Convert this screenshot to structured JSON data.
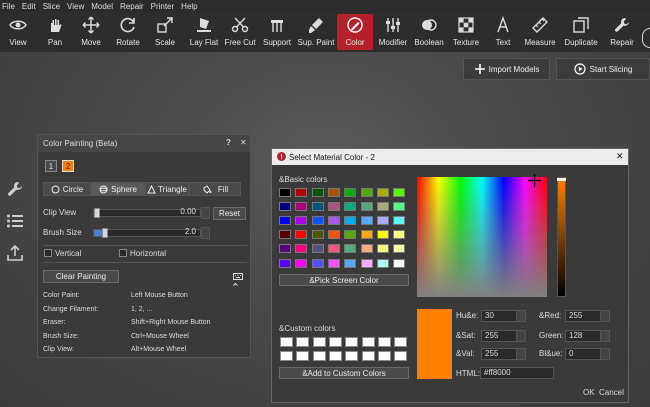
{
  "menu": [
    "File",
    "Edit",
    "Slice",
    "View",
    "Model",
    "Repair",
    "Printer",
    "Help"
  ],
  "toolbar": [
    {
      "label": "View",
      "icon": "eye-icon"
    },
    {
      "label": "Pan",
      "icon": "hand-icon"
    },
    {
      "label": "Move",
      "icon": "move-icon"
    },
    {
      "label": "Rotate",
      "icon": "rotate-icon"
    },
    {
      "label": "Scale",
      "icon": "scale-icon"
    },
    {
      "label": "Lay Flat",
      "icon": "lay-flat-icon"
    },
    {
      "label": "Free Cut",
      "icon": "cut-icon"
    },
    {
      "label": "Support",
      "icon": "support-icon"
    },
    {
      "label": "Sup. Paint",
      "icon": "support-paint-icon"
    },
    {
      "label": "Color",
      "icon": "color-icon"
    },
    {
      "label": "Modifier",
      "icon": "modifier-icon"
    },
    {
      "label": "Boolean",
      "icon": "boolean-icon"
    },
    {
      "label": "Texture",
      "icon": "texture-icon"
    },
    {
      "label": "Text",
      "icon": "text-icon"
    },
    {
      "label": "Measure",
      "icon": "ruler-icon"
    },
    {
      "label": "Duplicate",
      "icon": "duplicate-icon"
    },
    {
      "label": "Repair",
      "icon": "wrench-icon"
    }
  ],
  "top_actions": {
    "import": "Import Models",
    "slice": "Start Slicing"
  },
  "panel": {
    "title": "Color Painting (Beta)",
    "help": "?",
    "close": "✕",
    "filaments": [
      "1",
      "2"
    ],
    "shapes": [
      "Circle",
      "Sphere",
      "Triangle",
      "Fill"
    ],
    "clip_view_label": "Clip View",
    "clip_view_value": "0.00",
    "clip_view_fraction": 0.0,
    "reset": "Reset",
    "brush_size_label": "Brush Size",
    "brush_size_value": "2.0",
    "brush_size_fraction": 0.0,
    "vertical": "Vertical",
    "horizontal": "Horizontal",
    "clear": "Clear Painting",
    "shortcuts": [
      {
        "k": "Color Paint:",
        "v": "Left Mouse Button"
      },
      {
        "k": "Change Filament:",
        "v": "1, 2, ..."
      },
      {
        "k": "Eraser:",
        "v": "Shift+Right Mouse Button"
      },
      {
        "k": "Brush Size:",
        "v": "Ctrl+Mouse Wheel"
      },
      {
        "k": "Clip View:",
        "v": "Alt+Mouse Wheel"
      }
    ]
  },
  "dialog": {
    "title": "Select Material Color - 2",
    "basic_label": "&Basic colors",
    "basic_colors": [
      [
        "#000000",
        "#aa0000",
        "#005500",
        "#aa5500",
        "#00aa00",
        "#55aa00",
        "#aaaa00",
        "#55ff00"
      ],
      [
        "#00007f",
        "#aa007f",
        "#00557f",
        "#aa557f",
        "#00aa7f",
        "#55aa7f",
        "#aaaa7f",
        "#55ff7f"
      ],
      [
        "#0000ff",
        "#aa00ff",
        "#0055ff",
        "#aa55ff",
        "#00aaff",
        "#55aaff",
        "#aaaaff",
        "#55ffff"
      ],
      [
        "#550000",
        "#ff0000",
        "#555500",
        "#ff5500",
        "#55aa00",
        "#ffaa00",
        "#ffff00",
        "#ffff7f"
      ],
      [
        "#55007f",
        "#ff007f",
        "#55557f",
        "#ff557f",
        "#55aa7f",
        "#ffaa7f",
        "#ffff7f",
        "#ffffaa"
      ],
      [
        "#5500ff",
        "#ff00ff",
        "#5555ff",
        "#ff55ff",
        "#55aaff",
        "#ffaaff",
        "#aaffff",
        "#ffffff"
      ]
    ],
    "pick_screen": "&Pick Screen Color",
    "custom_label": "&Custom colors",
    "add_custom": "&Add to Custom Colors",
    "current_color": "#ff8000",
    "hue_label": "Hu&e:",
    "hue": "30",
    "sat_label": "&Sat:",
    "sat": "255",
    "val_label": "&Val:",
    "val": "255",
    "red_label": "&Red:",
    "red": "255",
    "green_label": "Green:",
    "green": "128",
    "blue_label": "Bl&ue:",
    "blue": "0",
    "html_label": "HTML:",
    "html": "#ff8000",
    "ok": "OK",
    "cancel": "Cancel"
  }
}
